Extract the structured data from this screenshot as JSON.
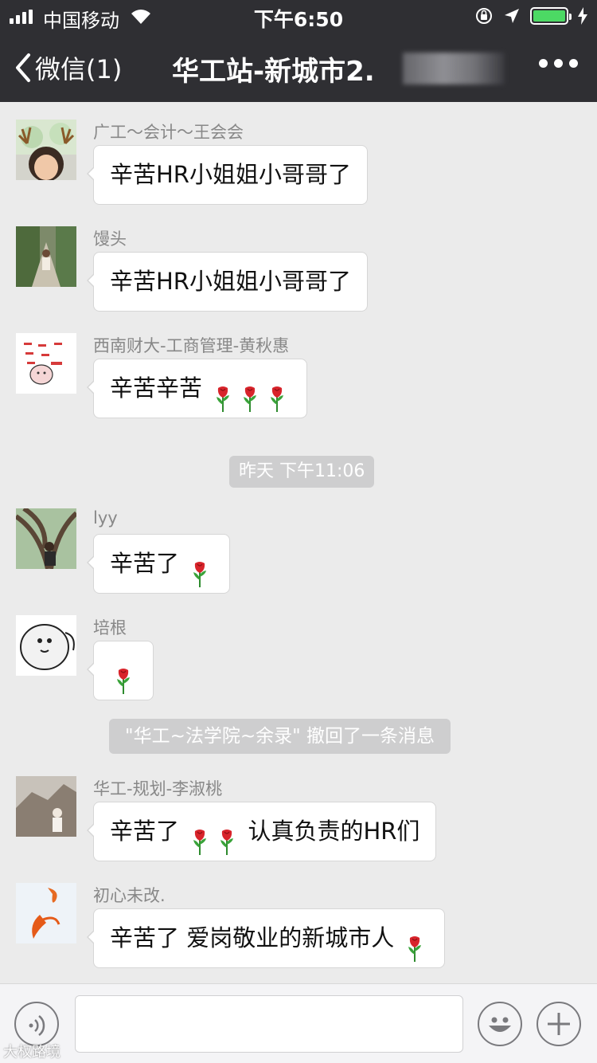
{
  "status": {
    "carrier": "中国移动",
    "time": "下午6:50"
  },
  "nav": {
    "back_label": "微信(1)",
    "title": "华工站-新城市2."
  },
  "messages": [
    {
      "sender": "广工～会计～王会会",
      "text": "辛苦HR小姐姐小哥哥了",
      "roses": 0
    },
    {
      "sender": "馒头",
      "text": "辛苦HR小姐姐小哥哥了",
      "roses": 0
    },
    {
      "sender": "西南财大-工商管理-黄秋惠",
      "text": "辛苦辛苦",
      "roses": 3
    },
    {
      "sender": "lyy",
      "text": "辛苦了",
      "roses": 1
    },
    {
      "sender": "培根",
      "text": "",
      "roses": 1
    },
    {
      "sender": "华工-规划-李淑桃",
      "text": "辛苦了",
      "roses": 2,
      "text_after": "认真负责的HR们"
    },
    {
      "sender": "初心未改.",
      "text": "辛苦了  爱岗敬业的新城市人",
      "roses": 1
    }
  ],
  "system": {
    "timestamp": "昨天 下午11:06",
    "recall_notice": "\"华工~法学院~余录\" 撤回了一条消息"
  },
  "watermark": "大权路境",
  "icons": {
    "voice": "voice-icon",
    "emoji": "emoji-icon",
    "add": "plus-icon"
  },
  "colors": {
    "nav_bg": "#2f2f33",
    "chat_bg": "#ebebeb",
    "battery": "#4cd964"
  }
}
